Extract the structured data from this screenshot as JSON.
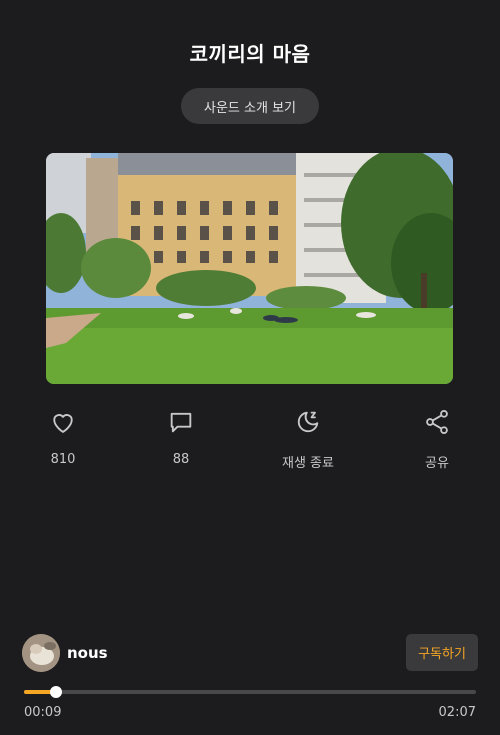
{
  "header": {
    "title": "코끼리의 마음",
    "sound_intro_label": "사운드 소개 보기"
  },
  "artwork": {
    "description_icon": "park-photo"
  },
  "actions": {
    "like": {
      "icon": "heart-icon",
      "label": "810"
    },
    "comment": {
      "icon": "comment-icon",
      "label": "88"
    },
    "sleep_timer": {
      "icon": "moon-zzz-icon",
      "label": "재생 종료"
    },
    "share": {
      "icon": "share-icon",
      "label": "공유"
    }
  },
  "creator": {
    "name": "nous",
    "subscribe_label": "구독하기"
  },
  "player": {
    "current_time": "00:09",
    "total_time": "02:07",
    "progress_fraction": 0.071
  },
  "colors": {
    "background": "#1c1c1e",
    "accent": "#f5a623",
    "button_bg": "#3a3a3c"
  }
}
